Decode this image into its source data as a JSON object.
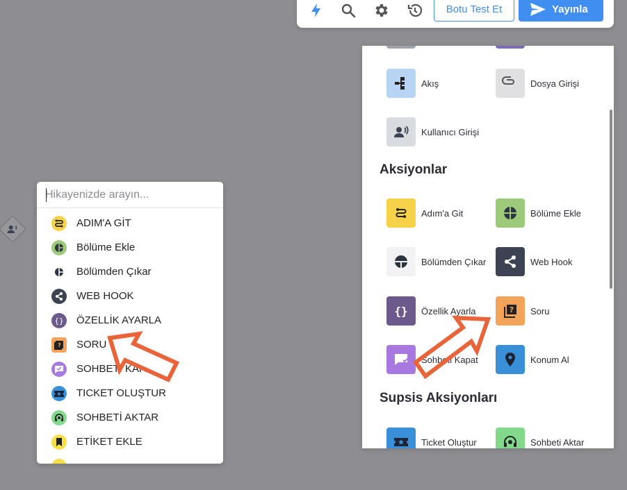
{
  "toolbar": {
    "icons": [
      "bolt-icon",
      "search-icon",
      "gear-icon",
      "history-icon"
    ],
    "test_label": "Botu Test Et",
    "publish_label": "Yayınla",
    "colors": {
      "accent": "#3f8ef0"
    }
  },
  "search": {
    "placeholder": "Hikayenizde arayın..."
  },
  "dropdown_items": [
    {
      "label": "ADIM'A GİT",
      "icon": "goto-step-icon",
      "color": "#f5d24a"
    },
    {
      "label": "Bölüme Ekle",
      "icon": "add-segment-icon",
      "color": "#9cc97a"
    },
    {
      "label": "Bölümden Çıkar",
      "icon": "remove-segment-icon",
      "color": "#ffffff"
    },
    {
      "label": "WEB HOOK",
      "icon": "share-icon",
      "color": "#3d4352"
    },
    {
      "label": "ÖZELLİK AYARLA",
      "icon": "braces-icon",
      "color": "#6d5a8c"
    },
    {
      "label": "SORU",
      "icon": "question-icon",
      "color": "#f4a45a"
    },
    {
      "label": "SOHBETİ KAPAT",
      "icon": "close-chat-icon",
      "color": "#a779e0"
    },
    {
      "label": "TICKET OLUŞTUR",
      "icon": "ticket-icon",
      "color": "#3a8fd9"
    },
    {
      "label": "SOHBETİ AKTAR",
      "icon": "headset-icon",
      "color": "#82d98c"
    },
    {
      "label": "ETİKET EKLE",
      "icon": "bookmark-icon",
      "color": "#f5e04a"
    }
  ],
  "panel": {
    "top_tiles": [
      {
        "label": "Akış",
        "icon": "flow-icon",
        "color": "#b8d4f5"
      },
      {
        "label": "Dosya Girişi",
        "icon": "paperclip-icon",
        "color": "#e0e0e2"
      },
      {
        "label": "Kullanıcı Girişi",
        "icon": "user-voice-icon",
        "color": "#d8dbe0"
      }
    ],
    "actions_title": "Aksiyonlar",
    "actions": [
      {
        "label": "Adım'a Git",
        "icon": "goto-step-icon",
        "color": "#f5d24a"
      },
      {
        "label": "Bölüme Ekle",
        "icon": "add-segment-icon",
        "color": "#9cc97a"
      },
      {
        "label": "Bölümden Çıkar",
        "icon": "remove-segment-icon",
        "color": "#f2f2f4"
      },
      {
        "label": "Web Hook",
        "icon": "share-icon",
        "color": "#3d4352"
      },
      {
        "label": "Özellik Ayarla",
        "icon": "braces-icon",
        "color": "#6d5a8c"
      },
      {
        "label": "Soru",
        "icon": "question-icon",
        "color": "#f4a45a"
      },
      {
        "label": "Sohbeti Kapat",
        "icon": "close-chat-icon",
        "color": "#a779e0"
      },
      {
        "label": "Konum Al",
        "icon": "location-icon",
        "color": "#3a8fd9"
      }
    ],
    "supsis_title": "Supsis Aksiyonları",
    "supsis_actions": [
      {
        "label": "Ticket Oluştur",
        "icon": "ticket-icon",
        "color": "#3a8fd9"
      },
      {
        "label": "Sohbeti Aktar",
        "icon": "headset-icon",
        "color": "#82d98c"
      }
    ]
  },
  "annotation_color": "#e8643a"
}
